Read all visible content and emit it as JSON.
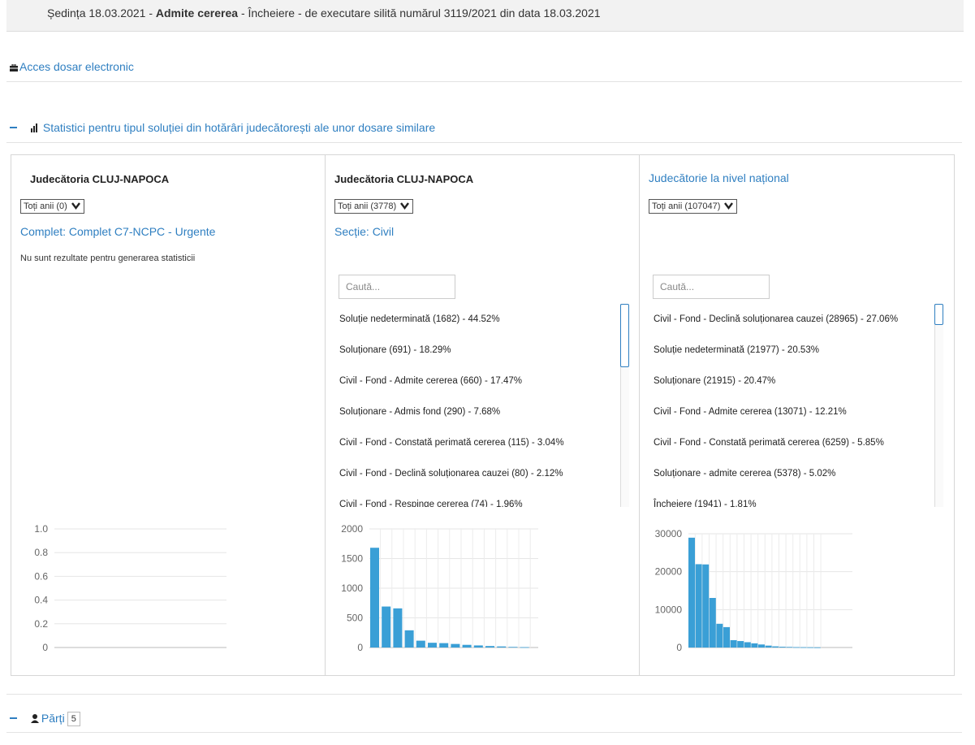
{
  "top": {
    "prefix": "Ședința 18.03.2021 - ",
    "bold": "Admite cererea",
    "rest": " - Încheiere - de executare silită numărul 3119/2021 din data 18.03.2021"
  },
  "acces": {
    "label": "Acces dosar electronic",
    "icon": "briefcase-icon"
  },
  "stats": {
    "title": "Statistici pentru tipul soluției din hotărâri judecătorești ale unor dosare similare",
    "icon": "bar-chart-icon",
    "collapse_icon": "minus-icon"
  },
  "columns": [
    {
      "court": "Judecătoria CLUJ-NAPOCA",
      "years": "Toți anii (0)",
      "sub": "Complet: Complet C7-NCPC - Urgente",
      "no_results": "Nu sunt rezultate pentru generarea statisticii"
    },
    {
      "court": "Judecătoria CLUJ-NAPOCA",
      "years": "Toți anii (3778)",
      "sub": "Secție: Civil",
      "search_placeholder": "Caută...",
      "items": [
        "Soluție nedeterminată (1682) - 44.52%",
        "Soluționare (691) - 18.29%",
        "Civil - Fond - Admite cererea (660) - 17.47%",
        "Soluționare - Admis fond (290) - 7.68%",
        "Civil - Fond - Constată perimată cererea (115) - 3.04%",
        "Civil - Fond - Declină soluționarea cauzei (80) - 2.12%",
        "Civil - Fond - Respinge cererea (74) - 1.96%"
      ]
    },
    {
      "court": "Judecătorie la nivel național",
      "years": "Toți anii (107047)",
      "search_placeholder": "Caută...",
      "items": [
        "Civil - Fond - Declină soluționarea cauzei (28965) - 27.06%",
        "Soluție nedeterminată (21977) - 20.53%",
        "Soluționare (21915) - 20.47%",
        "Civil - Fond - Admite cererea (13071) - 12.21%",
        "Civil - Fond - Constată perimată cererea (6259) - 5.85%",
        "Soluționare - admite cererea (5378) - 5.02%",
        "Încheiere (1941) - 1.81%"
      ]
    }
  ],
  "chart_data": [
    {
      "type": "bar",
      "ylim": [
        0,
        1.0
      ],
      "yticks": [
        "1.0",
        "0.8",
        "0.6",
        "0.4",
        "0.2",
        "0"
      ],
      "values": [],
      "color": "#3a9fd6"
    },
    {
      "type": "bar",
      "ylim": [
        0,
        2000
      ],
      "yticks": [
        "2000",
        "1500",
        "1000",
        "500",
        "0"
      ],
      "values": [
        1682,
        691,
        660,
        290,
        115,
        80,
        74,
        60,
        45,
        35,
        25,
        18,
        10,
        6
      ],
      "color": "#3a9fd6"
    },
    {
      "type": "bar",
      "ylim": [
        0,
        30000
      ],
      "yticks": [
        "30000",
        "20000",
        "10000",
        "0"
      ],
      "values": [
        28965,
        21977,
        21915,
        13071,
        6259,
        5378,
        1941,
        1700,
        1400,
        1100,
        800,
        500,
        300,
        200,
        150,
        100,
        80,
        60,
        40
      ],
      "color": "#3a9fd6"
    }
  ],
  "parti": {
    "label": "Părți",
    "count": "5",
    "icon": "user-icon"
  }
}
